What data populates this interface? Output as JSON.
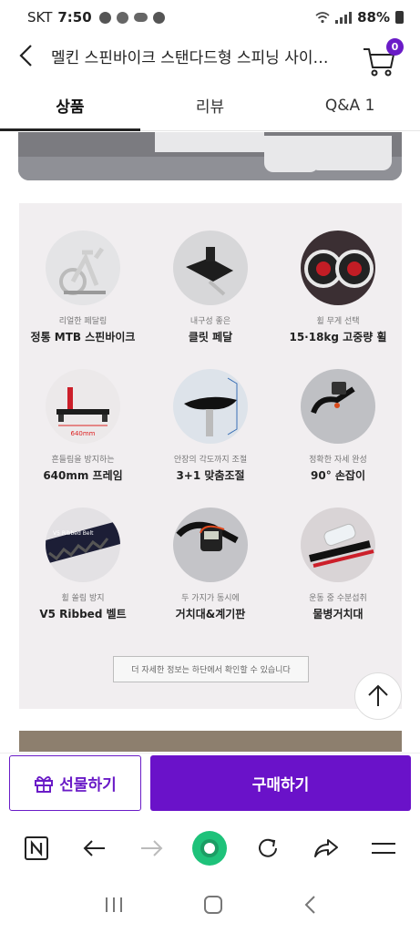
{
  "status_bar": {
    "carrier": "SKT",
    "time": "7:50",
    "battery": "88%"
  },
  "header": {
    "title": "멜킨 스핀바이크 스탠다드형 스피닝 사이…",
    "cart_count": "0"
  },
  "tabs": [
    {
      "label": "상품",
      "active": true
    },
    {
      "label": "리뷰",
      "active": false
    },
    {
      "label": "Q&A 1",
      "active": false
    }
  ],
  "features": [
    {
      "sub": "리얼한 페달링",
      "main": "정통 MTB 스핀바이크",
      "icon": "spin-bike-image"
    },
    {
      "sub": "내구성 좋은",
      "main": "클릿 페달",
      "icon": "pedal-image"
    },
    {
      "sub": "휠 무게 선택",
      "main": "15·18kg 고중량 휠",
      "icon": "flywheel-image"
    },
    {
      "sub": "흔들림을 방지하는",
      "main": "640mm 프레임",
      "icon": "frame-image"
    },
    {
      "sub": "안장의 각도까지 조절",
      "main": "3+1 맞춤조절",
      "icon": "saddle-image"
    },
    {
      "sub": "정확한 자세 완성",
      "main": "90° 손잡이",
      "icon": "handlebar-image"
    },
    {
      "sub": "휠 쏠림 방지",
      "main": "V5 Ribbed 벨트",
      "icon": "belt-image"
    },
    {
      "sub": "두 가지가 동시에",
      "main": "거치대&계기판",
      "icon": "console-image"
    },
    {
      "sub": "운동 중 수분섭취",
      "main": "물병거치대",
      "icon": "bottle-holder-image"
    }
  ],
  "feature_labels": {
    "frame_size": "640mm",
    "belt_text": "V5 Ribbed Belt"
  },
  "note": "더 자세한 정보는 하단에서 확인할 수 있습니다",
  "buy_bar": {
    "gift_label": "선물하기",
    "buy_label": "구매하기"
  },
  "colors": {
    "brand": "#6a12c9",
    "panel_bg": "#f1eef0"
  }
}
